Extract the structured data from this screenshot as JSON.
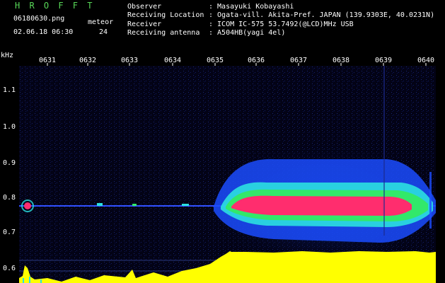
{
  "header": {
    "logo": "H R O F F T",
    "filename": "06180630.png",
    "datetime": "02.06.18 06:30",
    "meteor_label": "meteor",
    "meteor_count": "24",
    "observer_label": "Observer",
    "observer_value": ": Masayuki Kobayashi",
    "location_label": "Receiving Location",
    "location_value": ": Ogata-vill. Akita-Pref. JAPAN (139.9303E, 40.0231N)",
    "receiver_label": "Receiver",
    "receiver_value": ": ICOM IC-575 53.7492(@LCD)MHz USB",
    "antenna_label": "Receiving antenna",
    "antenna_value": ": A504HB(yagi 4el)"
  },
  "axis": {
    "unit": "kHz",
    "y_ticks": [
      "1.1",
      "1.0",
      "0.9",
      "0.8",
      "0.7",
      "0.6"
    ],
    "time_ticks": [
      "0631",
      "0632",
      "0633",
      "0634",
      "0635",
      "0636",
      "0637",
      "0638",
      "0639",
      "0640"
    ]
  },
  "colors": {
    "background": "#000000",
    "plot_background": "#030316",
    "logo": "#58d858",
    "signal_core": "#ff2d6e",
    "signal_mid": "#27e88a",
    "signal_outer": "#1b5cff",
    "echo_counts": "#ffff00"
  }
}
